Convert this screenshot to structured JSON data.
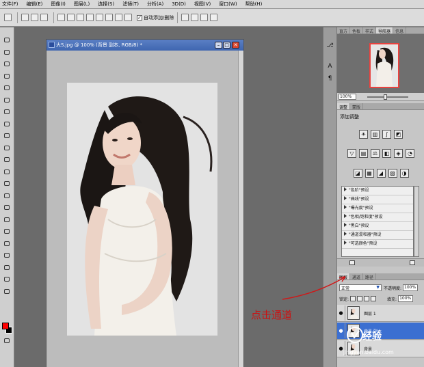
{
  "menu": [
    "文件(F)",
    "编辑(E)",
    "图像(I)",
    "图层(L)",
    "选择(S)",
    "滤镜(T)",
    "分析(A)",
    "3D(D)",
    "视图(V)",
    "窗口(W)",
    "帮助(H)"
  ],
  "options_bar": {
    "auto_add_delete_label": "自动添加/删除",
    "auto_add_delete_checked": true
  },
  "document": {
    "title": "大S.jpg @ 100% (背景 副本, RGB/8) *"
  },
  "navigator": {
    "tabs": [
      "直方",
      "色板",
      "样式",
      "导航器",
      "信息"
    ],
    "active_tab": "导航器",
    "zoom": "100%"
  },
  "adjustments": {
    "tabs": [
      "调整",
      "蒙版"
    ],
    "title": "添加调整",
    "icon_rows": [
      [
        "brightness-icon",
        "levels-icon",
        "curves-icon",
        "exposure-icon"
      ],
      [
        "vibrance-icon",
        "hue-sat-icon",
        "color-balance-icon",
        "bw-icon",
        "photo-filter-icon",
        "channel-mixer-icon"
      ],
      [
        "invert-icon",
        "posterize-icon",
        "threshold-icon",
        "gradient-map-icon",
        "selective-color-icon"
      ]
    ],
    "presets": [
      "\"色阶\"预设",
      "\"曲线\"预设",
      "\"曝光度\"预设",
      "\"色相/饱和度\"预设",
      "\"黑白\"预设",
      "\"通道混和器\"预设",
      "\"可选颜色\"预设"
    ]
  },
  "layers": {
    "tabs": [
      "图层",
      "通道",
      "路径"
    ],
    "blend_mode": "正常",
    "opacity_label": "不透明度:",
    "opacity": "100%",
    "lock_label": "锁定:",
    "fill_label": "填充:",
    "fill": "100%",
    "items": [
      {
        "name": "图层 1",
        "selected": false
      },
      {
        "name": "背景 副本",
        "selected": true
      },
      {
        "name": "背景",
        "selected": false
      }
    ]
  },
  "annotation": {
    "text": "点击通道",
    "color": "#cc1111"
  },
  "watermark": {
    "brand": "经验",
    "url": "jingyan.baidu.com"
  },
  "colors": {
    "foreground": "#ff0000",
    "background": "#000000",
    "selection": "#3b6fd1"
  }
}
